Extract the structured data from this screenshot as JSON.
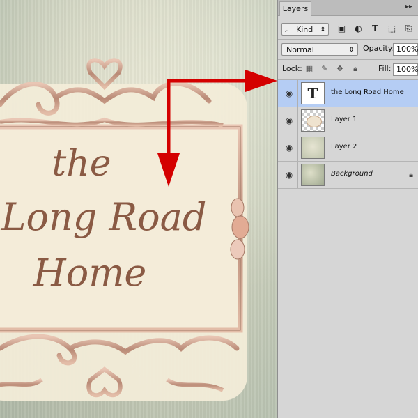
{
  "artwork": {
    "lines": [
      "the",
      "Long Road",
      "Home"
    ]
  },
  "panel": {
    "tab_label": "Layers",
    "menu_icon": "panel-menu-icon",
    "filter": {
      "kind_label": "Kind",
      "icons": [
        "image-filter-icon",
        "adjustment-filter-icon",
        "type-filter-icon",
        "shape-filter-icon",
        "smart-object-filter-icon"
      ]
    },
    "blend_mode": "Normal",
    "opacity_label": "Opacity:",
    "opacity_value": "100%",
    "lock_label": "Lock:",
    "fill_label": "Fill:",
    "fill_value": "100%",
    "layers": [
      {
        "name": "the Long Road Home",
        "thumb": "type-layer-thumb",
        "selected": true,
        "italic": false
      },
      {
        "name": "Layer 1",
        "thumb": "frame-layer-thumb",
        "selected": false,
        "italic": false
      },
      {
        "name": "Layer 2",
        "thumb": "paper-layer-thumb",
        "selected": false,
        "italic": false
      },
      {
        "name": "Background",
        "thumb": "background-layer-thumb",
        "selected": false,
        "italic": true,
        "locked": true
      }
    ]
  },
  "colors": {
    "annotation_arrow": "#d40000",
    "title_text": "#8a5a44",
    "selected_layer": "#b5cdf4"
  }
}
